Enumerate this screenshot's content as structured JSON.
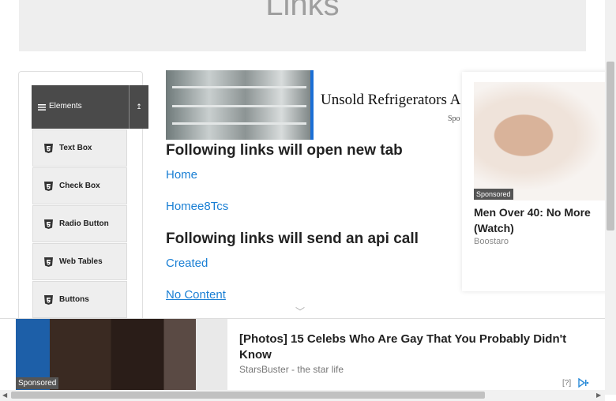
{
  "page": {
    "title": "Links"
  },
  "sidebar": {
    "group_label": "Elements",
    "items": [
      {
        "label": "Text Box"
      },
      {
        "label": "Check Box"
      },
      {
        "label": "Radio Button"
      },
      {
        "label": "Web Tables"
      },
      {
        "label": "Buttons"
      }
    ]
  },
  "ads": {
    "top": {
      "title": "Unsold Refrigerators A",
      "sponsored": "Spo"
    },
    "side": {
      "badge": "Sponsored",
      "headline": "Men Over 40: No More (Watch)",
      "source": "Boostaro"
    },
    "bottom": {
      "badge": "Sponsored",
      "headline": "[Photos] 15 Celebs Who Are Gay That You Probably Didn't Know",
      "source": "StarsBuster - the star life",
      "help": "[?]"
    }
  },
  "main": {
    "new_tab_heading": "Following links will open new tab",
    "new_tab_links": [
      "Home",
      "Homee8Tcs"
    ],
    "api_heading": "Following links will send an api call",
    "api_links": [
      "Created",
      "No Content"
    ]
  },
  "colors": {
    "link": "#1a7fd4",
    "group_header": "#4a4a4a",
    "header_band": "#eeeeee"
  }
}
